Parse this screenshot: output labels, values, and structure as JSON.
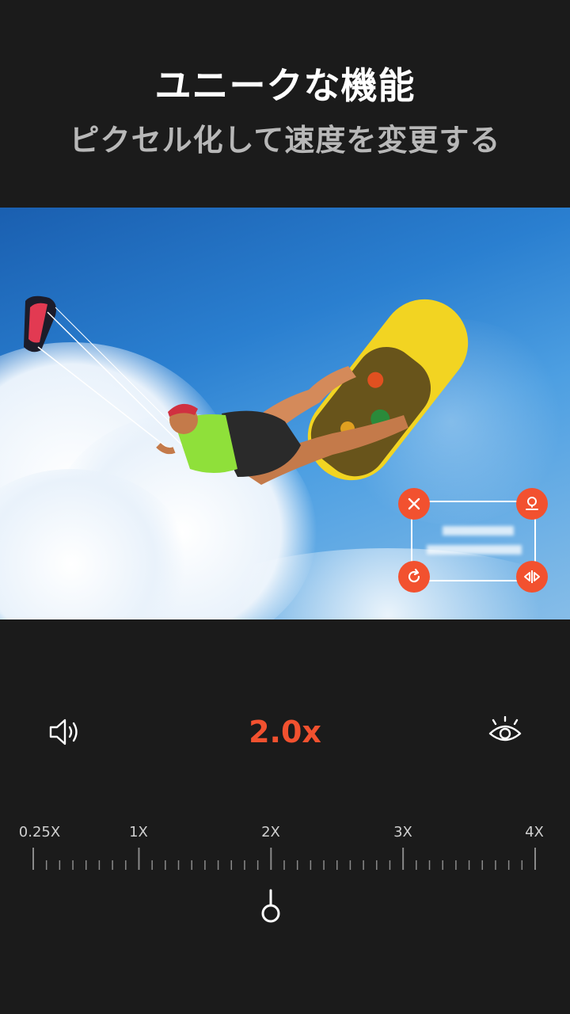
{
  "header": {
    "title": "ユニークな機能",
    "subtitle": "ピクセル化して速度を変更する"
  },
  "sticker": {
    "delete_icon": "close-icon",
    "pin_icon": "pin-icon",
    "rotate_icon": "rotate-icon",
    "flip_icon": "flip-icon"
  },
  "controls": {
    "speed_value": "2.0x",
    "volume_icon": "speaker-icon",
    "visibility_icon": "eye-icon",
    "accent_color": "#f2512f"
  },
  "speed_ruler": {
    "labels": [
      "0.25X",
      "1X",
      "2X",
      "3X",
      "4X"
    ],
    "selected": "2X"
  }
}
